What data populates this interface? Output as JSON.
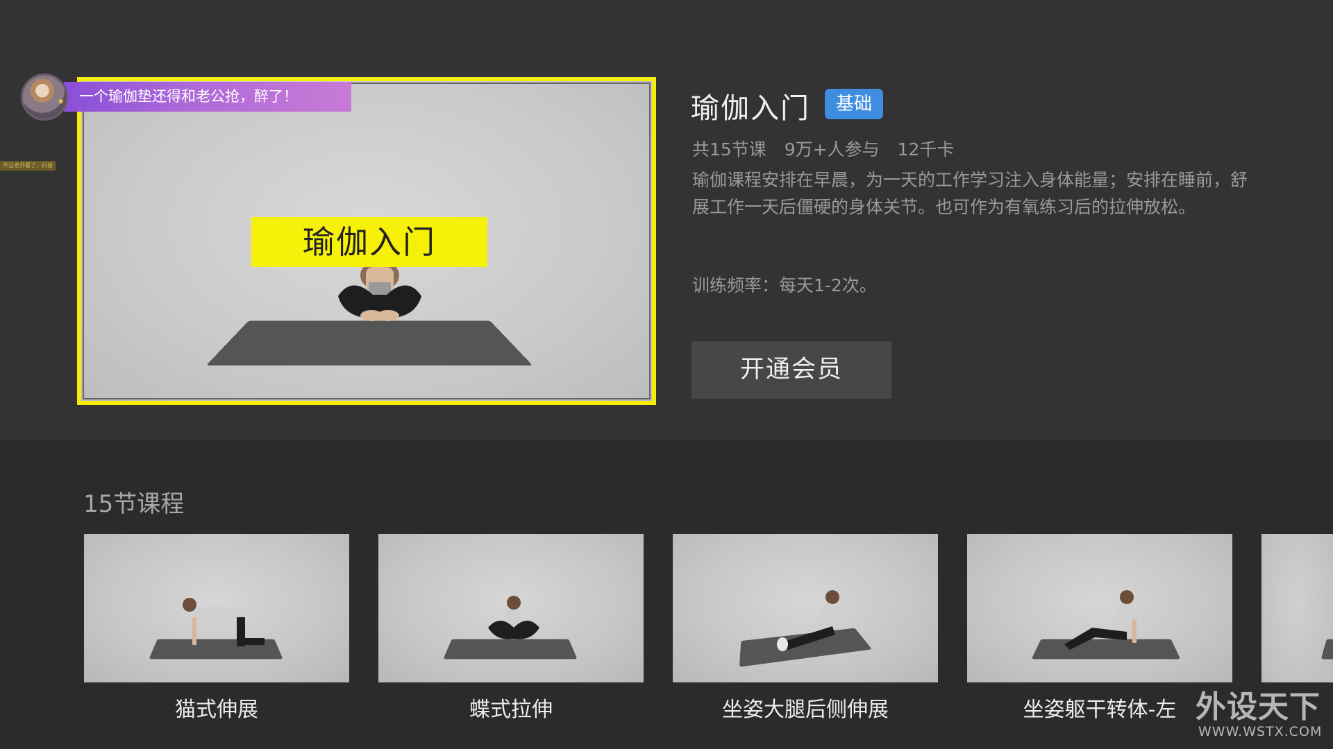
{
  "danmaku": {
    "text": "一个瑜伽垫还得和老公抢，醉了！",
    "side_tag": "不让老师看了，抖音"
  },
  "video": {
    "overlay_title": "瑜伽入门"
  },
  "course": {
    "title": "瑜伽入门",
    "level_badge": "基础",
    "stats": {
      "lessons": "共15节课",
      "participants": "9万+人参与",
      "calories": "12千卡"
    },
    "description": "瑜伽课程安排在早晨，为一天的工作学习注入身体能量；安排在睡前，舒展工作一天后僵硬的身体关节。也可作为有氧练习后的拉伸放松。",
    "frequency": "训练频率：每天1-2次。",
    "join_button": "开通会员"
  },
  "lessons_section": {
    "heading": "15节课程",
    "items": [
      {
        "label": "猫式伸展"
      },
      {
        "label": "蝶式拉伸"
      },
      {
        "label": "坐姿大腿后侧伸展"
      },
      {
        "label": "坐姿躯干转体-左"
      }
    ]
  },
  "watermark": {
    "cn": "外设天下",
    "en": "WWW.WSTX.COM"
  },
  "colors": {
    "focus_border": "#f7ec0a",
    "badge_blue": "#3f8de0",
    "danmaku_purple": "#b06ad8",
    "background": "#333333"
  }
}
